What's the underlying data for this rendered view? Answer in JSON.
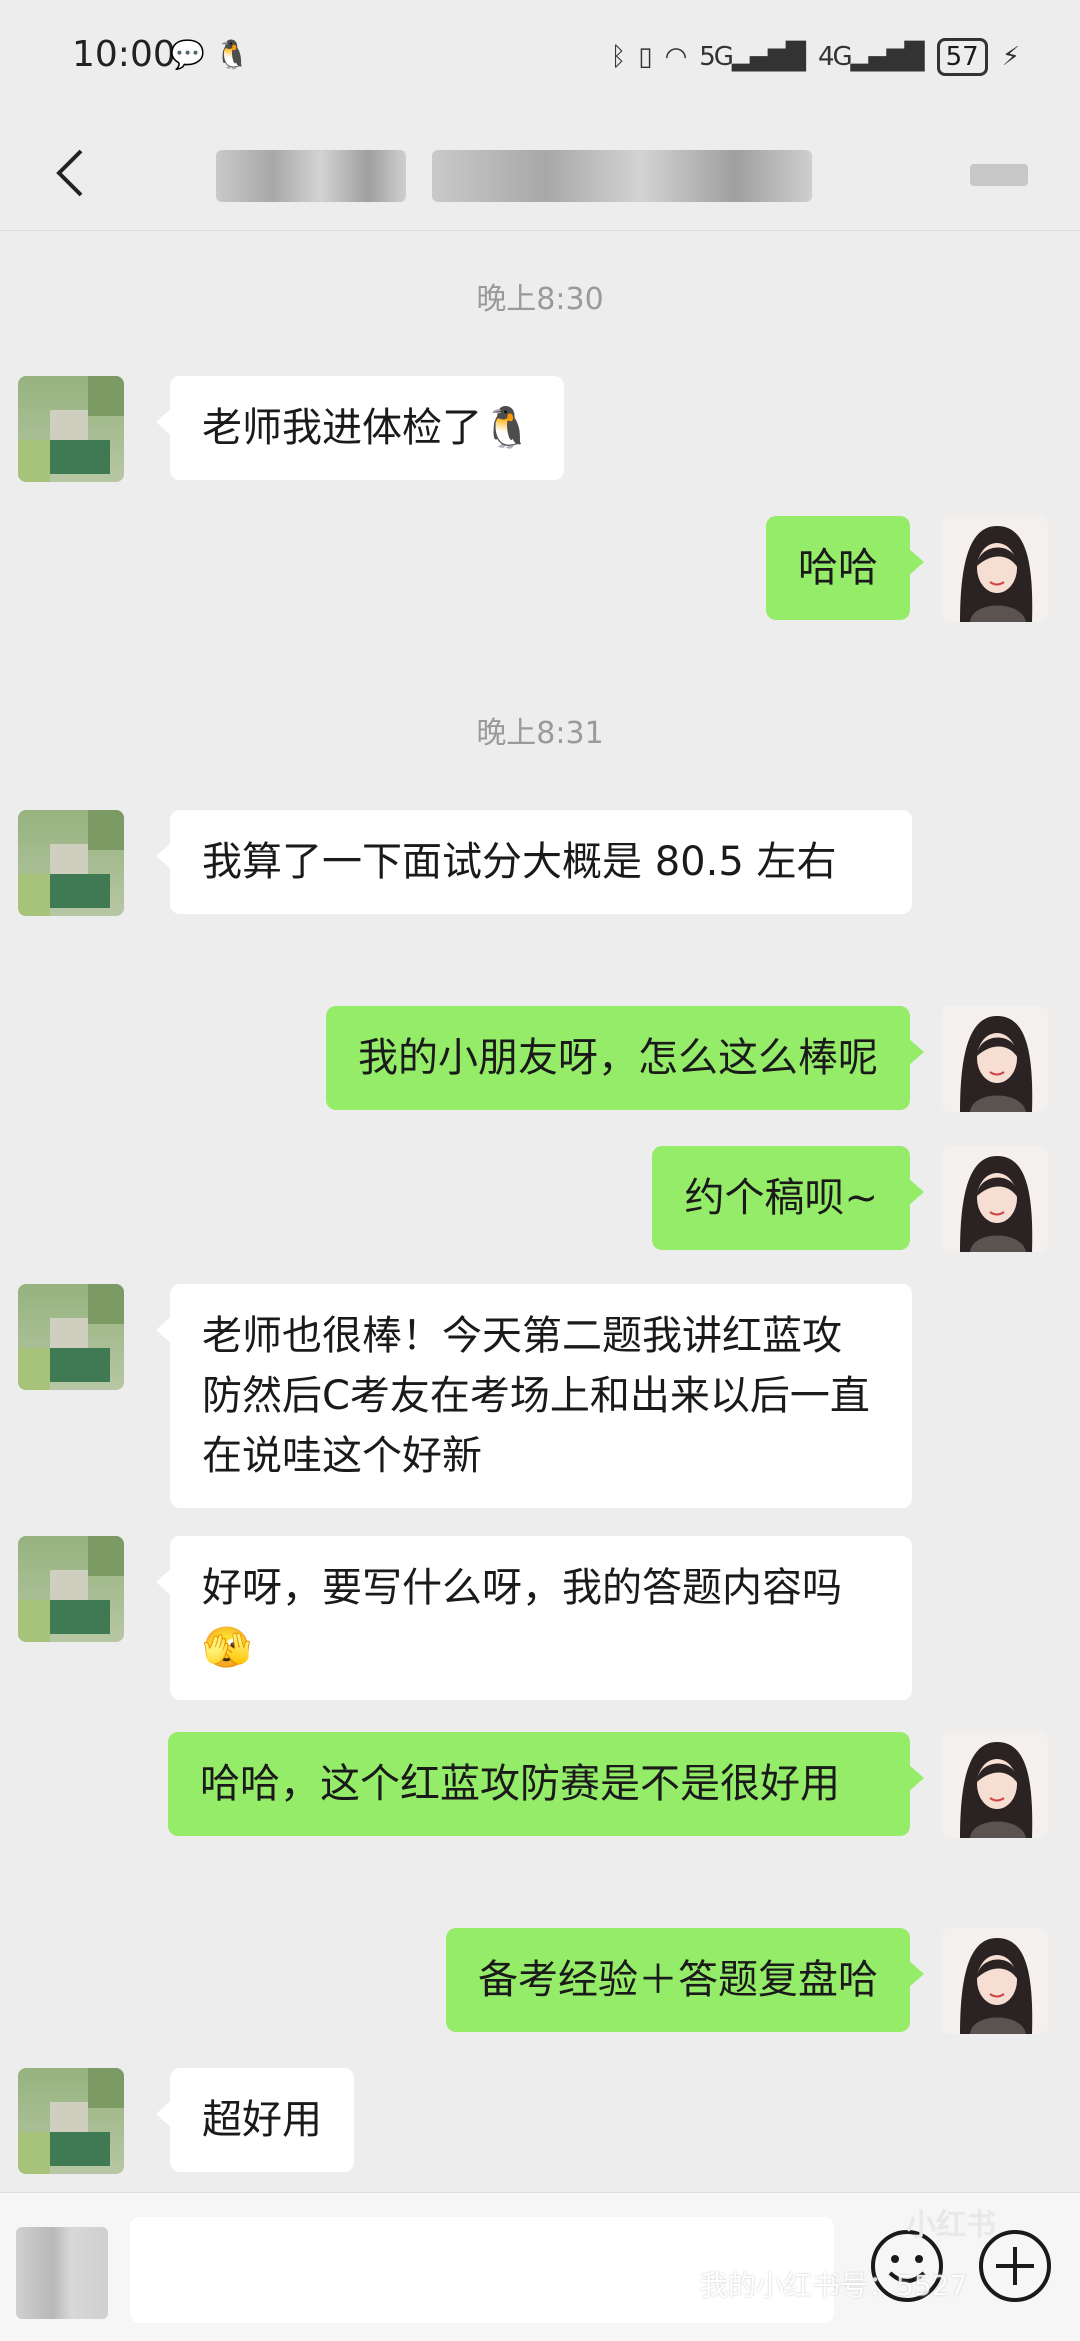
{
  "status_bar": {
    "time": "10:00",
    "left_icons": [
      "wechat-icon",
      "qq-icon"
    ],
    "right_icons": [
      "bluetooth-icon",
      "vibrate-icon",
      "wifi-icon",
      "signal-5g-icon",
      "signal-4g-icon"
    ],
    "network_5g": "5G",
    "network_4g": "4G",
    "battery": "57"
  },
  "header": {
    "title_blurred": true
  },
  "messages": [
    {
      "type": "timestamp",
      "text": "晚上8:30"
    },
    {
      "type": "in",
      "text": "老师我进体检了",
      "emoji": "🐧"
    },
    {
      "type": "out",
      "text": "哈哈"
    },
    {
      "type": "timestamp",
      "text": "晚上8:31"
    },
    {
      "type": "in",
      "text": "我算了一下面试分大概是 80.5 左右"
    },
    {
      "type": "out",
      "text": "我的小朋友呀，怎么这么棒呢"
    },
    {
      "type": "out",
      "text": "约个稿呗~"
    },
    {
      "type": "in",
      "text": "老师也很棒！今天第二题我讲红蓝攻防然后C考友在考场上和出来以后一直在说哇这个好新"
    },
    {
      "type": "in",
      "text": "好呀，要写什么呀，我的答题内容吗",
      "emoji": "🫣"
    },
    {
      "type": "out",
      "text": "哈哈，这个红蓝攻防赛是不是很好用"
    },
    {
      "type": "out",
      "text": "备考经验＋答题复盘哈"
    },
    {
      "type": "in",
      "text": "超好用"
    }
  ],
  "input_bar": {
    "placeholder": "",
    "emoji_button": "emoji-icon",
    "plus_button": "plus-icon"
  },
  "watermark": {
    "logo": "小红书",
    "text": "我的小红书号：5527"
  },
  "colors": {
    "background": "#ededed",
    "outgoing_bubble": "#95ec69",
    "incoming_bubble": "#ffffff"
  }
}
